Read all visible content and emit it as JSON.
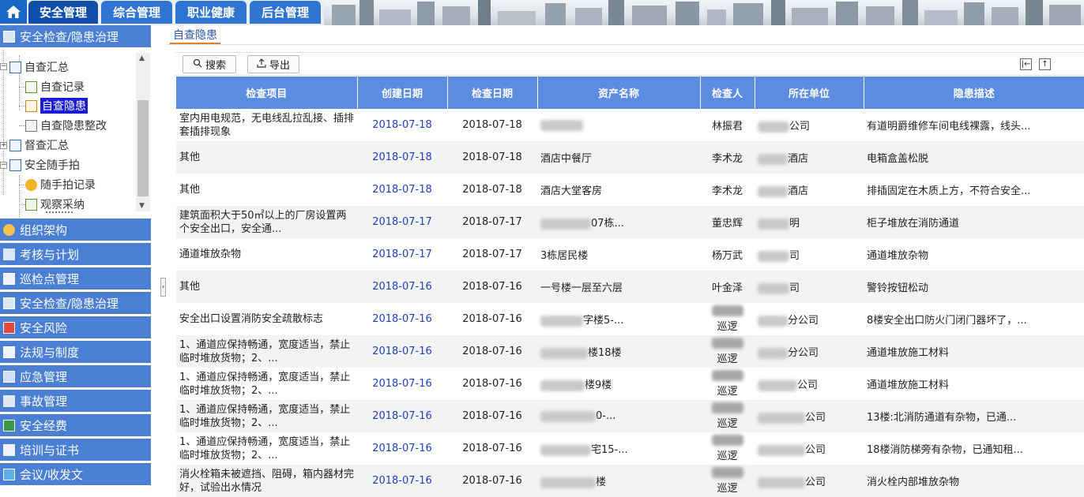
{
  "top_nav": {
    "home_icon": "home-icon",
    "tabs": [
      {
        "label": "安全管理"
      },
      {
        "label": "综合管理"
      },
      {
        "label": "职业健康"
      },
      {
        "label": "后台管理"
      }
    ]
  },
  "sidebar": {
    "active_section": "安全检查/隐患治理",
    "tree": {
      "group1": "自查汇总",
      "item1": "自查记录",
      "item2": "自查隐患",
      "item3": "自查隐患整改",
      "group2": "督查汇总",
      "group3": "安全随手拍",
      "item4": "随手拍记录",
      "item5": "观察采纳"
    },
    "sections": [
      {
        "label": "组织架构",
        "icon": "people-icon"
      },
      {
        "label": "考核与计划",
        "icon": "book-icon"
      },
      {
        "label": "巡检点管理",
        "icon": "checklist-icon"
      },
      {
        "label": "安全检查/隐患治理",
        "icon": "inspection-icon"
      },
      {
        "label": "安全风险",
        "icon": "risk-icon"
      },
      {
        "label": "法规与制度",
        "icon": "regulation-icon"
      },
      {
        "label": "应急管理",
        "icon": "emergency-icon"
      },
      {
        "label": "事故管理",
        "icon": "accident-icon"
      },
      {
        "label": "安全经费",
        "icon": "funds-icon"
      },
      {
        "label": "培训与证书",
        "icon": "certificate-icon"
      },
      {
        "label": "会议/收发文",
        "icon": "meeting-icon"
      }
    ]
  },
  "content": {
    "tab_label": "自查隐患",
    "toolbar": {
      "search_label": "搜索",
      "export_label": "导出"
    },
    "columns": [
      "检查项目",
      "创建日期",
      "检查日期",
      "资产名称",
      "检查人",
      "所在单位",
      "隐患描述"
    ],
    "rows": [
      {
        "item": "室内用电规范，无电线乱拉乱接、插排套插排现象",
        "created": "2018-07-18",
        "checked": "2018-07-18",
        "asset": "",
        "inspector": "林振君",
        "unit": "公司",
        "desc": "有道明爵维修车间电线裸露，线头..."
      },
      {
        "item": "其他",
        "created": "2018-07-18",
        "checked": "2018-07-18",
        "asset": "酒店中餐厅",
        "inspector": "李术龙",
        "unit": "酒店",
        "desc": "电箱盒盖松脱"
      },
      {
        "item": "其他",
        "created": "2018-07-18",
        "checked": "2018-07-18",
        "asset": "酒店大堂客房",
        "inspector": "李术龙",
        "unit": "酒店",
        "desc": "排插固定在木质上方，不符合安全..."
      },
      {
        "item": "建筑面积大于50㎡以上的厂房设置两个安全出口，安全通...",
        "created": "2018-07-17",
        "checked": "2018-07-17",
        "asset": "07栋...",
        "inspector": "董忠辉",
        "unit": "明",
        "desc": "柜子堆放在消防通道"
      },
      {
        "item": "通道堆放杂物",
        "created": "2018-07-17",
        "checked": "2018-07-17",
        "asset": "3栋居民楼",
        "inspector": "杨万武",
        "unit": "司",
        "desc": "通道堆放杂物"
      },
      {
        "item": "其他",
        "created": "2018-07-16",
        "checked": "2018-07-16",
        "asset": "一号楼一层至六层",
        "inspector": "叶金泽",
        "unit": "司",
        "desc": "警铃按钮松动"
      },
      {
        "item": "安全出口设置消防安全疏散标志",
        "created": "2018-07-16",
        "checked": "2018-07-16",
        "asset": "字楼5-...",
        "inspector": "巡逻",
        "unit": "分公司",
        "desc": "8楼安全出口防火门闭门器坏了，..."
      },
      {
        "item": "1、通道应保持畅通，宽度适当，禁止临时堆放货物；2、...",
        "created": "2018-07-16",
        "checked": "2018-07-16",
        "asset": "楼18楼",
        "inspector": "巡逻",
        "unit": "分公司",
        "desc": "通道堆放施工材料"
      },
      {
        "item": "1、通道应保持畅通，宽度适当，禁止临时堆放货物；2、...",
        "created": "2018-07-16",
        "checked": "2018-07-16",
        "asset": "楼9楼",
        "inspector": "巡逻",
        "unit": "公司",
        "desc": "通道堆放施工材料"
      },
      {
        "item": "1、通道应保持畅通，宽度适当，禁止临时堆放货物；2、...",
        "created": "2018-07-16",
        "checked": "2018-07-16",
        "asset": "0-...",
        "inspector": "巡逻",
        "unit": "公司",
        "desc": "13楼:北消防通道有杂物，已通..."
      },
      {
        "item": "1、通道应保持畅通，宽度适当，禁止临时堆放货物；2、...",
        "created": "2018-07-16",
        "checked": "2018-07-16",
        "asset": "宅15-...",
        "inspector": "巡逻",
        "unit": "公司",
        "desc": "18楼消防梯旁有杂物，已通知租..."
      },
      {
        "item": "消火栓箱未被遮挡、阻碍，箱内器材完好，试验出水情况",
        "created": "2018-07-16",
        "checked": "2018-07-16",
        "asset": "楼",
        "inspector": "巡逻",
        "unit": "公司",
        "desc": "消火栓内部堆放杂物"
      }
    ]
  }
}
